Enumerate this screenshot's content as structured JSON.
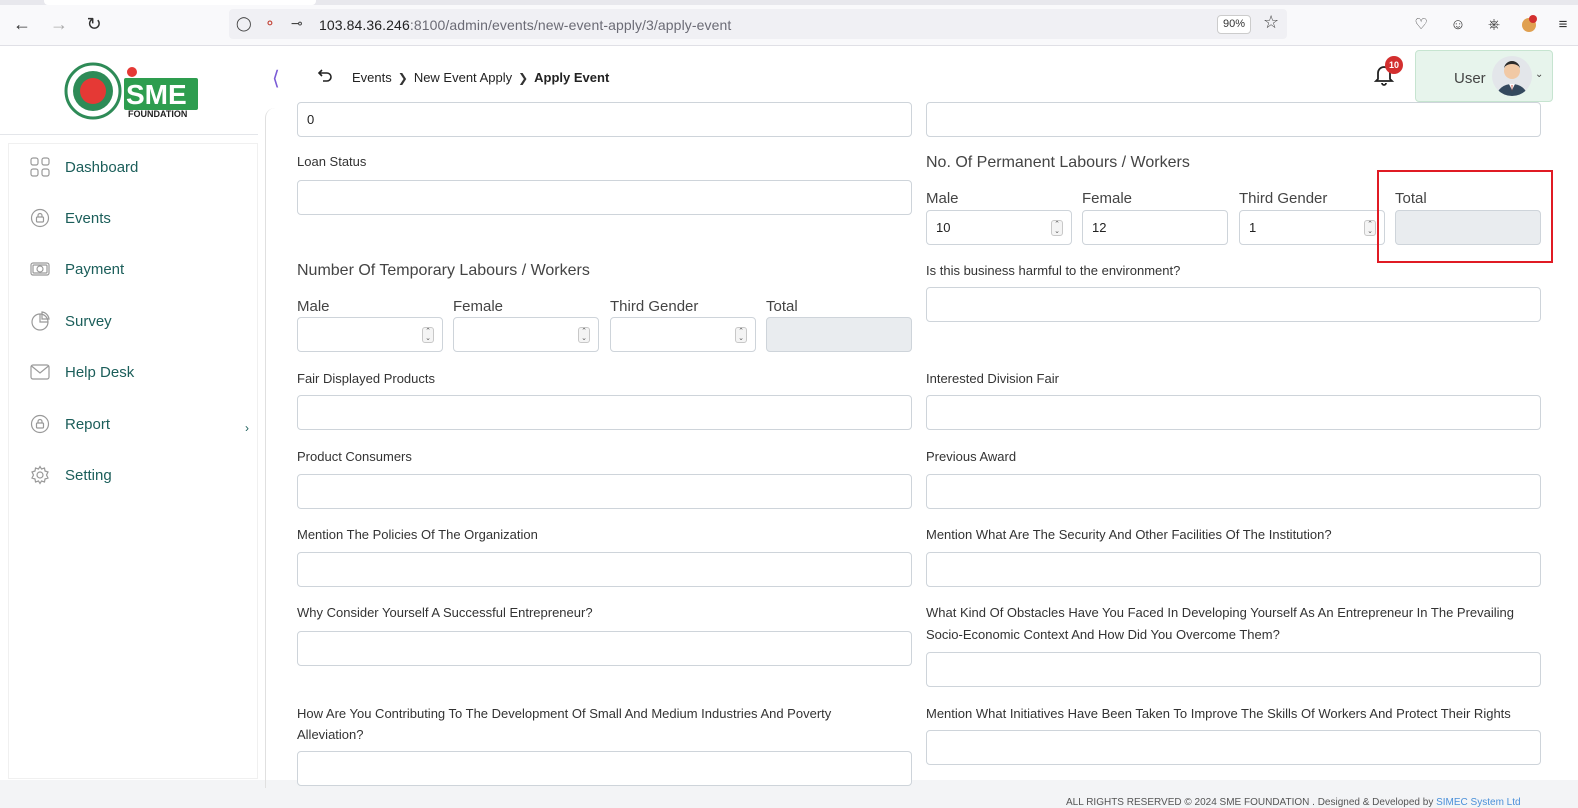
{
  "browser": {
    "url_host": "103.84.36.246",
    "url_path": ":8100/admin/events/new-event-apply/3/apply-event",
    "zoom": "90%"
  },
  "breadcrumb": {
    "items": [
      "Events",
      "New Event Apply"
    ],
    "current": "Apply Event"
  },
  "notifications": {
    "count": "10"
  },
  "user": {
    "name": "User"
  },
  "logo": {
    "brand": "SME",
    "sub": "FOUNDATION"
  },
  "sidebar": {
    "items": [
      {
        "label": "Dashboard",
        "icon": "grid-icon"
      },
      {
        "label": "Events",
        "icon": "lock-icon"
      },
      {
        "label": "Payment",
        "icon": "money-icon"
      },
      {
        "label": "Survey",
        "icon": "pie-chart-icon"
      },
      {
        "label": "Help Desk",
        "icon": "envelope-icon"
      },
      {
        "label": "Report",
        "icon": "lock-icon"
      },
      {
        "label": "Setting",
        "icon": "gear-icon"
      }
    ]
  },
  "form": {
    "top_left_value": "0",
    "loan_status_label": "Loan Status",
    "permanent": {
      "title": "No. Of Permanent Labours / Workers",
      "male_label": "Male",
      "male_value": "10",
      "female_label": "Female",
      "female_value": "12",
      "third_label": "Third Gender",
      "third_value": "1",
      "total_label": "Total",
      "total_value": ""
    },
    "temporary": {
      "title": "Number Of Temporary Labours / Workers",
      "male_label": "Male",
      "female_label": "Female",
      "third_label": "Third Gender",
      "total_label": "Total"
    },
    "harmful_label": "Is this business harmful to the environment?",
    "fair_displayed_label": "Fair Displayed Products",
    "interested_division_label": "Interested Division Fair",
    "product_consumers_label": "Product Consumers",
    "previous_award_label": "Previous Award",
    "policies_label": "Mention The Policies Of The Organization",
    "security_label": "Mention What Are The Security And Other Facilities Of The Institution?",
    "successful_label": "Why Consider Yourself A Successful Entrepreneur?",
    "obstacles_label_1": "What Kind Of Obstacles Have You Faced In Developing Yourself As An Entrepreneur In The Prevailing",
    "obstacles_label_2": "Socio-Economic Context And How Did You Overcome Them?",
    "contributing_label_1": "How Are You Contributing To The Development Of Small And Medium Industries And Poverty",
    "contributing_label_2": "Alleviation?",
    "initiatives_label": "Mention What Initiatives Have Been Taken To Improve The Skills Of Workers And Protect Their Rights"
  },
  "footer": {
    "text": "ALL RIGHTS RESERVED © 2024 SME FOUNDATION . Designed & Developed by",
    "link": "SIMEC System Ltd"
  }
}
